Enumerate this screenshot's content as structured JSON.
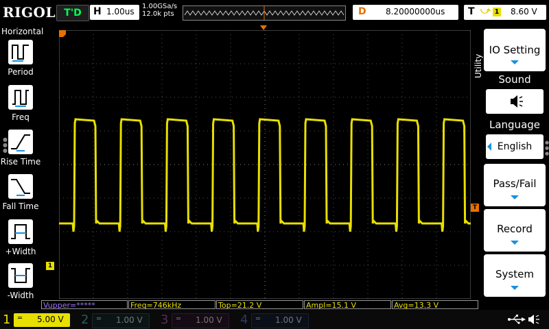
{
  "brand": "RIGOL",
  "status": "T'D",
  "horizontal": {
    "label": "H",
    "timebase": "1.00us",
    "sample_rate": "1.00GSa/s",
    "points": "12.0k pts"
  },
  "delay": {
    "label": "D",
    "value": "8.20000000us"
  },
  "trigger": {
    "label": "T",
    "channel": "1",
    "level": "8.60 V"
  },
  "left_menu": {
    "title": "Horizontal",
    "items": [
      {
        "label": "Period"
      },
      {
        "label": "Freq"
      },
      {
        "label": "Rise Time"
      },
      {
        "label": "Fall Time"
      },
      {
        "label": "+Width"
      },
      {
        "label": "-Width"
      }
    ]
  },
  "right_menu": {
    "tab": "Utility",
    "io_setting": "IO Setting",
    "sound": "Sound",
    "language": "Language",
    "language_value": "English",
    "pass_fail": "Pass/Fail",
    "record": "Record",
    "system": "System"
  },
  "markers": {
    "ch1": "1",
    "trig": "T"
  },
  "measurements": [
    {
      "text": "Vupper=*****"
    },
    {
      "text": "Freq=746kHz"
    },
    {
      "text": "Top=21.2 V"
    },
    {
      "text": "Ampl=15.1 V"
    },
    {
      "text": "Avg=13.3 V"
    }
  ],
  "channels": [
    {
      "num": "1",
      "scale": "5.00 V",
      "color": "#e8e000"
    },
    {
      "num": "2",
      "scale": "1.00 V",
      "color": "#00c8c8"
    },
    {
      "num": "3",
      "scale": "1.00 V",
      "color": "#d000d0"
    },
    {
      "num": "4",
      "scale": "1.00 V",
      "color": "#2070ff"
    }
  ],
  "colors": {
    "ch1": "#e8e000",
    "accent": "#1a8fe0",
    "trigger_marker": "#e87000",
    "status": "#00ff55"
  }
}
